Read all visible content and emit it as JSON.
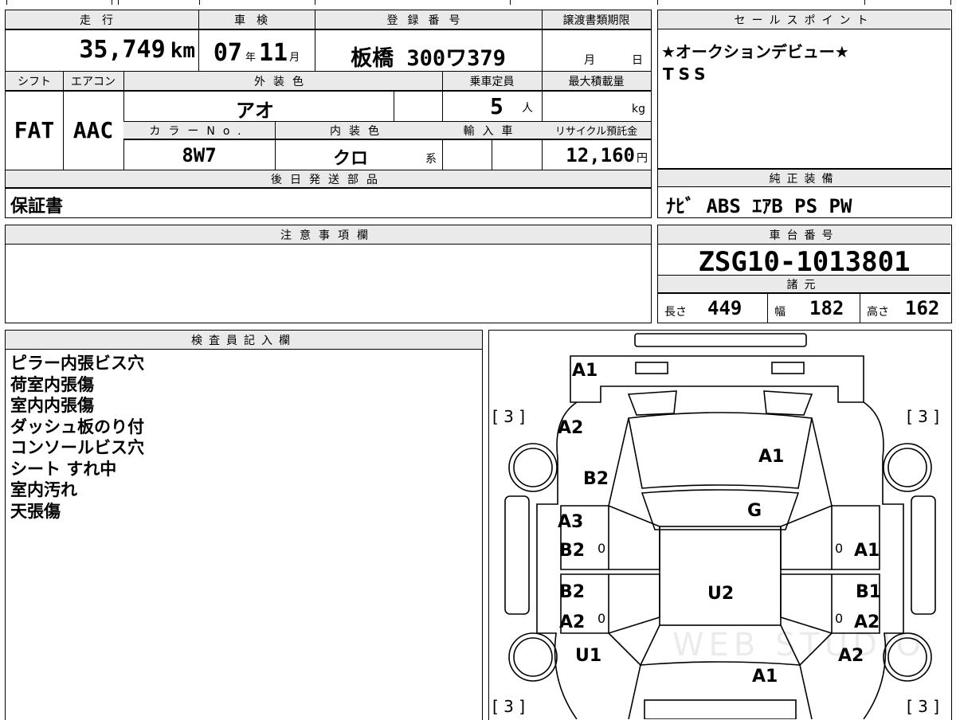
{
  "labels": {
    "mileage": "走行",
    "inspection": "車検",
    "registration": "登録番号",
    "transfer_deadline": "譲渡書類期限",
    "sales_points": "セールスポイント",
    "shift": "シフト",
    "aircon": "エアコン",
    "exterior_color": "外装色",
    "capacity": "乗車定員",
    "max_load": "最大積載量",
    "color_no": "カラーNo.",
    "interior_color": "内装色",
    "import": "輸入車",
    "recycle_fee": "リサイクル預託金",
    "later_parts": "後日発送部品",
    "factory_equipment": "純正装備",
    "remarks": "注意事項欄",
    "chassis_no": "車台番号",
    "specs": "諸元",
    "length": "長さ",
    "width": "幅",
    "height": "高さ",
    "inspector": "検査員記入欄"
  },
  "values": {
    "mileage": "35,749",
    "mileage_unit": "km",
    "inspection_year": "07",
    "year_unit": "年",
    "inspection_month": "11",
    "month_unit": "月",
    "registration": "板橋 300ワ379",
    "deadline_month": "月",
    "deadline_day": "日",
    "sales_points": [
      "★オークションデビュー★",
      "TSS"
    ],
    "shift": "FAT",
    "aircon": "AAC",
    "exterior_color": "アオ",
    "capacity": "5",
    "capacity_unit": "人",
    "max_load_unit": "kg",
    "color_no": "8W7",
    "interior_color": "クロ",
    "interior_suffix": "系",
    "recycle_fee": "12,160",
    "yen": "円",
    "later_parts": "保証書",
    "factory_equipment": "ﾅﾋﾞ ABS ｴｱB PS PW",
    "chassis_no": "ZSG10-1013801",
    "length": "449",
    "width": "182",
    "height": "162",
    "inspector_notes": [
      "ピラー内張ビス穴",
      "荷室内張傷",
      "室内内張傷",
      "ダッシュ板のり付",
      "コンソールビス穴",
      "シート すれ中",
      "室内汚れ",
      "天張傷"
    ]
  },
  "diagram": {
    "watermark": "WEB STUDIO",
    "tire_marks": [
      "[ 3 ]",
      "[ 3 ]",
      "[ 3 ]",
      "[ 3 ]"
    ],
    "zero_marks": [
      "0",
      "0",
      "0",
      "0"
    ],
    "marks": {
      "rear": "A1",
      "rear_left_quarter": "A2",
      "rear_glass": "A1",
      "left_rear_fender": "B2",
      "roof": "G",
      "left_rear_door_a": "A3",
      "left_rear_door_b": "B2",
      "right_rear_door": "A1",
      "left_front_door_b": "B2",
      "left_front_door_a": "A2",
      "right_front_door_b": "B1",
      "right_front_door_a": "A2",
      "floor": "U2",
      "left_front_fender": "U1",
      "right_front_fender": "A2",
      "hood": "A1"
    }
  }
}
